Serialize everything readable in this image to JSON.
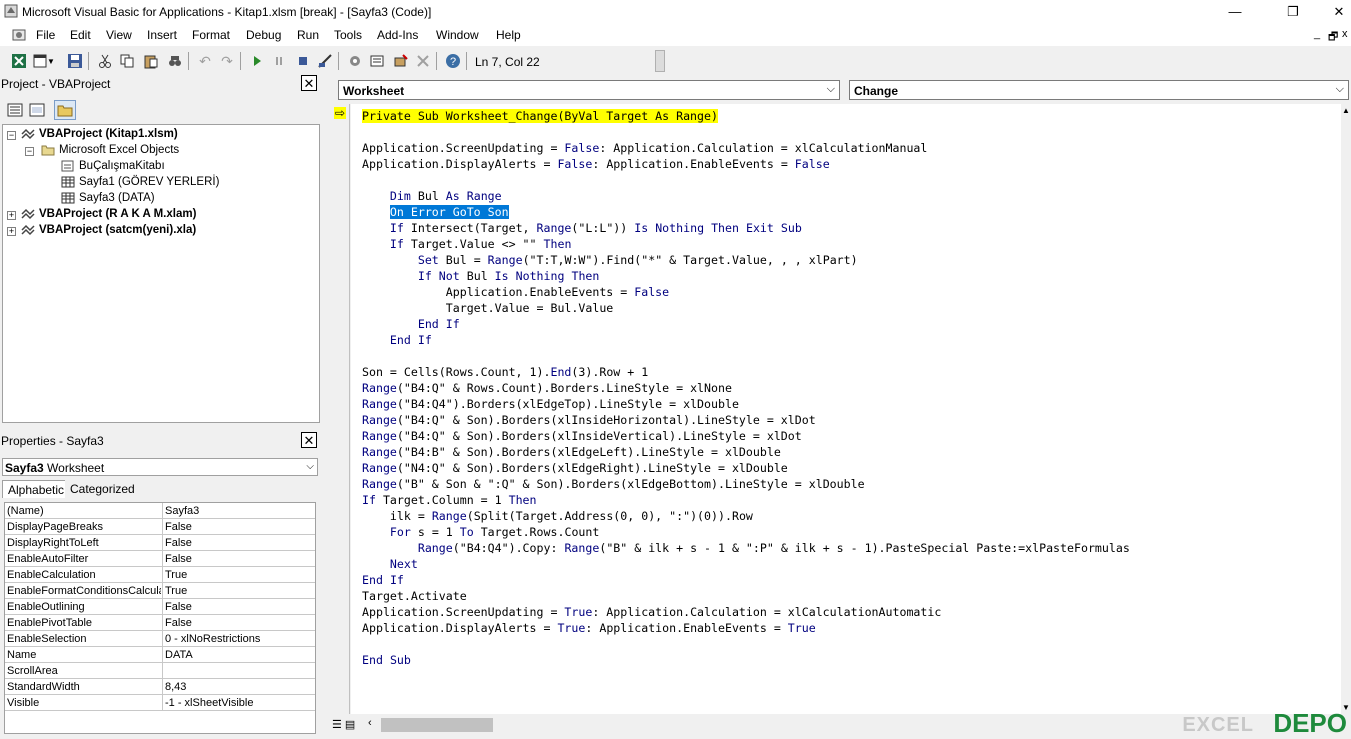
{
  "window": {
    "title": "Microsoft Visual Basic for Applications - Kitap1.xlsm [break] - [Sayfa3 (Code)]",
    "minimize": "—",
    "maximize": "❐",
    "close": "✕"
  },
  "menu": {
    "items": [
      "File",
      "Edit",
      "View",
      "Insert",
      "Format",
      "Debug",
      "Run",
      "Tools",
      "Add-Ins",
      "Window",
      "Help"
    ],
    "mdi_minimize": "_",
    "mdi_restore": "🗗",
    "mdi_close": "x"
  },
  "toolbar": {
    "cursor_position": "Ln 7, Col 22"
  },
  "project": {
    "title": "Project - VBAProject",
    "close": "✕",
    "tree": [
      {
        "label": "VBAProject (Kitap1.xlsm)",
        "bold": true
      },
      {
        "label": "Microsoft Excel Objects",
        "bold": false
      },
      {
        "label": "BuÇalışmaKitabı",
        "bold": false
      },
      {
        "label": "Sayfa1 (GÖREV YERLERİ)",
        "bold": false
      },
      {
        "label": "Sayfa3 (DATA)",
        "bold": false
      },
      {
        "label": "VBAProject (R A K A M.xlam)",
        "bold": true
      },
      {
        "label": "VBAProject (satcm(yeni).xla)",
        "bold": true
      }
    ]
  },
  "properties": {
    "title": "Properties - Sayfa3",
    "close": "✕",
    "object_name": "Sayfa3",
    "object_type": "Worksheet",
    "tabs": [
      "Alphabetic",
      "Categorized"
    ],
    "rows": [
      {
        "name": "(Name)",
        "value": "Sayfa3"
      },
      {
        "name": "DisplayPageBreaks",
        "value": "False"
      },
      {
        "name": "DisplayRightToLeft",
        "value": "False"
      },
      {
        "name": "EnableAutoFilter",
        "value": "False"
      },
      {
        "name": "EnableCalculation",
        "value": "True"
      },
      {
        "name": "EnableFormatConditionsCalculati",
        "value": "True"
      },
      {
        "name": "EnableOutlining",
        "value": "False"
      },
      {
        "name": "EnablePivotTable",
        "value": "False"
      },
      {
        "name": "EnableSelection",
        "value": "0 - xlNoRestrictions"
      },
      {
        "name": "Name",
        "value": "DATA"
      },
      {
        "name": "ScrollArea",
        "value": ""
      },
      {
        "name": "StandardWidth",
        "value": "8,43"
      },
      {
        "name": "Visible",
        "value": "-1 - xlSheetVisible"
      }
    ]
  },
  "code": {
    "object_combo": "Worksheet",
    "procedure_combo": "Change",
    "lines": [
      "Private Sub Worksheet_Change(ByVal Target As Range)",
      "",
      "Application.ScreenUpdating = False: Application.Calculation = xlCalculationManual",
      "Application.DisplayAlerts = False: Application.EnableEvents = False",
      "",
      "    Dim Bul As Range",
      "    On Error GoTo Son",
      "    If Intersect(Target, Range(\"L:L\")) Is Nothing Then Exit Sub",
      "    If Target.Value <> \"\" Then",
      "        Set Bul = Range(\"T:T,W:W\").Find(\"*\" & Target.Value, , , xlPart)",
      "        If Not Bul Is Nothing Then",
      "            Application.EnableEvents = False",
      "            Target.Value = Bul.Value",
      "        End If",
      "    End If",
      "",
      "Son = Cells(Rows.Count, 1).End(3).Row + 1",
      "Range(\"B4:Q\" & Rows.Count).Borders.LineStyle = xlNone",
      "Range(\"B4:Q4\").Borders(xlEdgeTop).LineStyle = xlDouble",
      "Range(\"B4:Q\" & Son).Borders(xlInsideHorizontal).LineStyle = xlDot",
      "Range(\"B4:Q\" & Son).Borders(xlInsideVertical).LineStyle = xlDot",
      "Range(\"B4:B\" & Son).Borders(xlEdgeLeft).LineStyle = xlDouble",
      "Range(\"N4:Q\" & Son).Borders(xlEdgeRight).LineStyle = xlDouble",
      "Range(\"B\" & Son & \":Q\" & Son).Borders(xlEdgeBottom).LineStyle = xlDouble",
      "If Target.Column = 1 Then",
      "    ilk = Range(Split(Target.Address(0, 0), \":\")(0)).Row",
      "    For s = 1 To Target.Rows.Count",
      "        Range(\"B4:Q4\").Copy: Range(\"B\" & ilk + s - 1 & \":P\" & ilk + s - 1).PasteSpecial Paste:=xlPasteFormulas",
      "    Next",
      "End If",
      "Target.Activate",
      "Application.ScreenUpdating = True: Application.Calculation = xlCalculationAutomatic",
      "Application.DisplayAlerts = True: Application.EnableEvents = True",
      "",
      "End Sub"
    ],
    "execution_line": 0,
    "selection": {
      "line": 6,
      "text": "On Error GoTo Son"
    }
  },
  "watermark": {
    "excel": "EXCEL",
    "depo": "DEPO"
  },
  "colors": {
    "keyword": "#00007f",
    "exec_highlight": "#ffff00",
    "selection": "#0078d7"
  }
}
